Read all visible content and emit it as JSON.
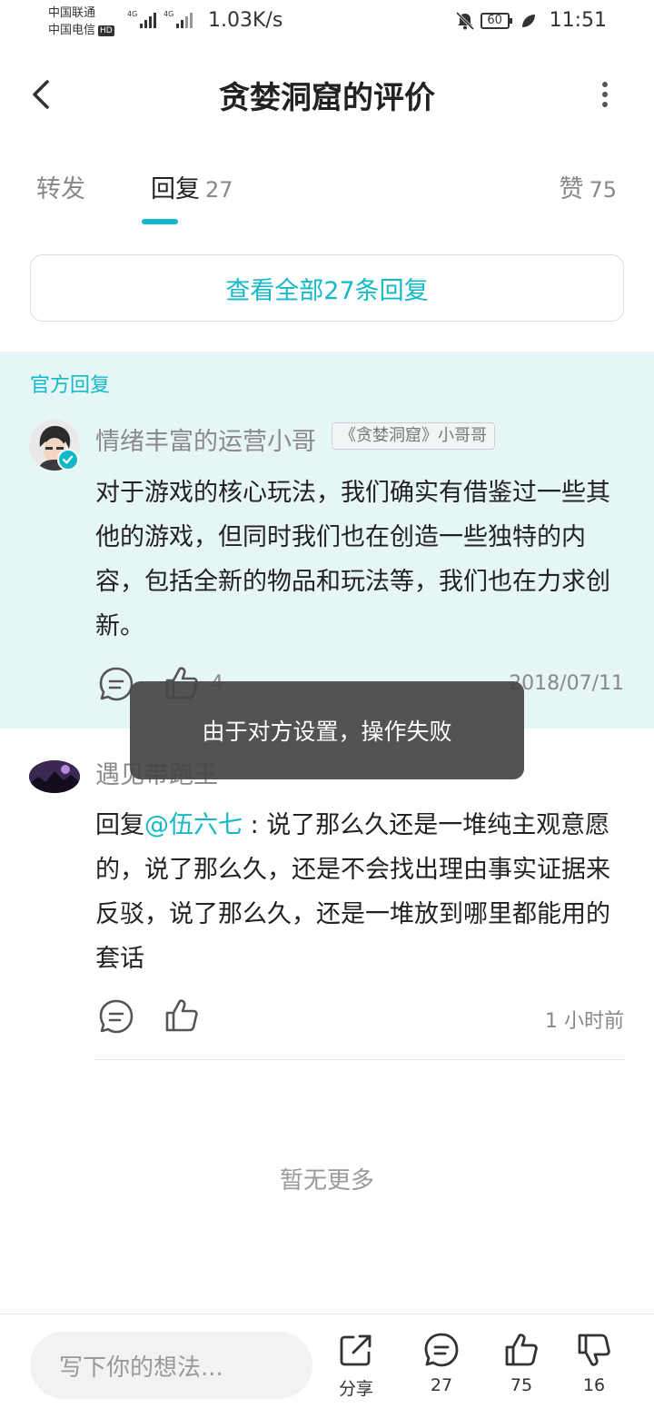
{
  "status_bar": {
    "carrier_1": "中国联通",
    "carrier_2": "中国电信",
    "hd_badge": "HD",
    "net_speed": "1.03K/s",
    "battery": "60",
    "time": "11:51"
  },
  "header": {
    "title": "贪婪洞窟的评价"
  },
  "tabs": [
    {
      "label": "转发",
      "count": ""
    },
    {
      "label": "回复",
      "count": "27"
    },
    {
      "label": "赞",
      "count": "75"
    }
  ],
  "view_all_label": "查看全部27条回复",
  "official_reply": {
    "section_label": "官方回复",
    "username": "情绪丰富的运营小哥",
    "role_tag": "《贪婪洞窟》小哥哥",
    "content": "对于游戏的核心玩法，我们确实有借鉴过一些其他的游戏，但同时我们也在创造一些独特的内容，包括全新的物品和玩法等，我们也在力求创新。",
    "like_count": "4",
    "date": "2018/07/11"
  },
  "reply": {
    "username": "遇见带跑王",
    "prefix": "回复",
    "mention": "@伍六七",
    "content": " : 说了那么久还是一堆纯主观意愿的，说了那么久，还是不会找出理由事实证据来反驳，说了那么久，还是一堆放到哪里都能用的套话",
    "time": "1 小时前"
  },
  "no_more_label": "暂无更多",
  "toast": "由于对方设置，操作失败",
  "bottom_bar": {
    "input_placeholder": "写下你的想法...",
    "share_label": "分享",
    "comment_count": "27",
    "like_count": "75",
    "dislike_count": "16"
  },
  "colors": {
    "accent": "#14b9c8",
    "official_bg": "#e6f6f7",
    "toast_bg": "#464646"
  }
}
